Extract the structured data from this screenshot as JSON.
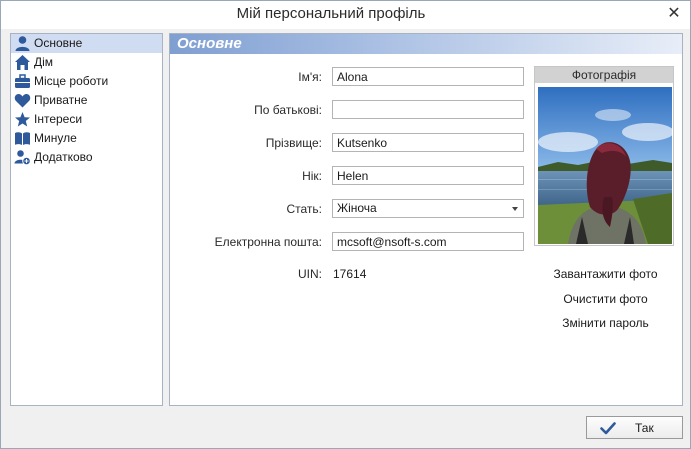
{
  "window": {
    "title": "Мій персональний профіль",
    "close_icon": "close-icon"
  },
  "sidebar": {
    "items": [
      {
        "label": "Основне",
        "icon": "user-icon",
        "active": true
      },
      {
        "label": "Дім",
        "icon": "home-icon"
      },
      {
        "label": "Місце роботи",
        "icon": "briefcase-icon"
      },
      {
        "label": "Приватне",
        "icon": "heart-icon"
      },
      {
        "label": "Інтереси",
        "icon": "star-icon"
      },
      {
        "label": "Минуле",
        "icon": "book-icon"
      },
      {
        "label": "Додатково",
        "icon": "user-add-icon"
      }
    ]
  },
  "main": {
    "header": "Основне",
    "fields": {
      "first_name": {
        "label": "Ім'я:",
        "value": "Alona"
      },
      "patronymic": {
        "label": "По батькові:",
        "value": ""
      },
      "last_name": {
        "label": "Прізвище:",
        "value": "Kutsenko"
      },
      "nick": {
        "label": "Нік:",
        "value": "Helen"
      },
      "gender": {
        "label": "Стать:",
        "value": "Жіноча"
      },
      "email": {
        "label": "Електронна пошта:",
        "value": "mcsoft@nsoft-s.com"
      },
      "uin": {
        "label": "UIN:",
        "value": "17614"
      }
    },
    "photo": {
      "title": "Фотографія",
      "upload": "Завантажити фото",
      "clear": "Очистити фото",
      "change_password": "Змінити пароль"
    }
  },
  "footer": {
    "ok_label": "Так"
  },
  "colors": {
    "accent": "#2e5a9c",
    "active_item": "#cfdcf1",
    "header_gradient_start": "#7f9fd1"
  }
}
